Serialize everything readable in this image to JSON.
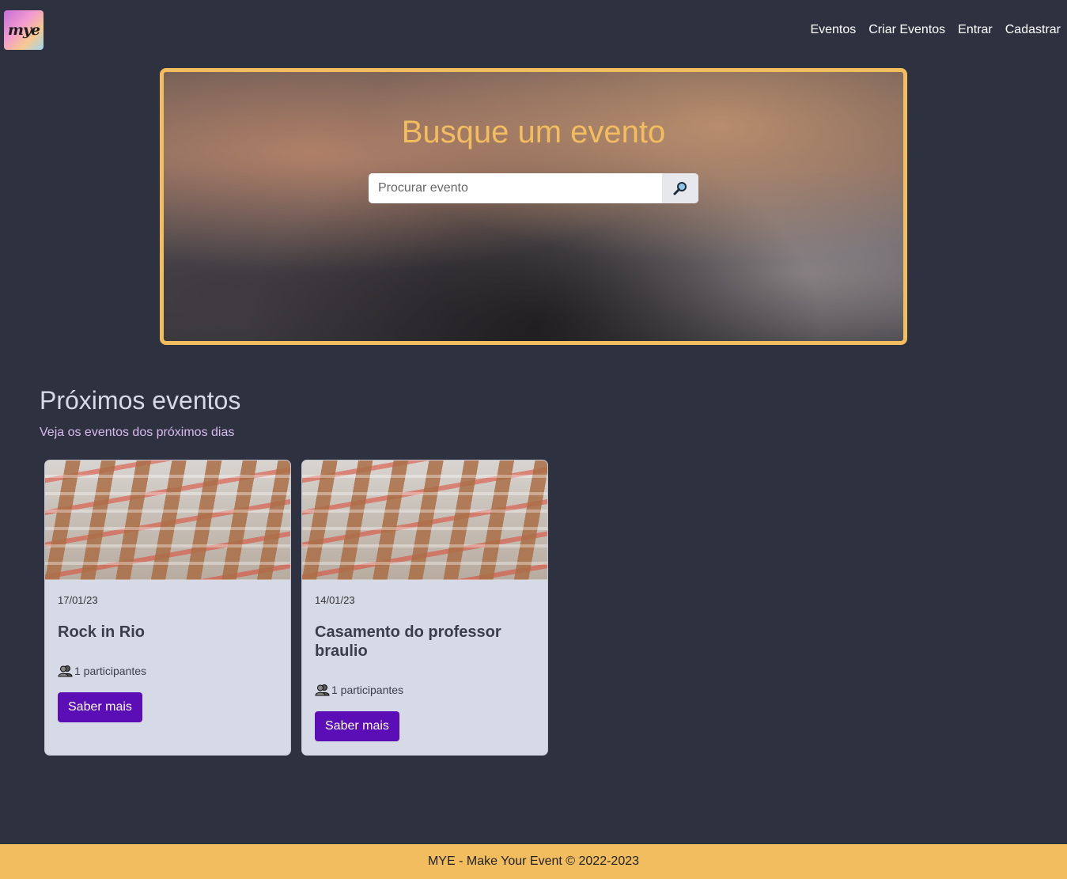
{
  "header": {
    "logo_text": "mye",
    "nav": [
      "Eventos",
      "Criar Eventos",
      "Entrar",
      "Cadastrar"
    ]
  },
  "hero": {
    "title": "Busque um evento",
    "search_placeholder": "Procurar evento",
    "search_icon": "magnifier-icon"
  },
  "section": {
    "title": "Próximos eventos",
    "subtitle": "Veja os eventos dos próximos dias"
  },
  "events": [
    {
      "date": "17/01/23",
      "title": "Rock in Rio",
      "participants": "1 participantes",
      "button": "Saber mais"
    },
    {
      "date": "14/01/23",
      "title": "Casamento do professor braulio",
      "participants": "1 participantes",
      "button": "Saber mais"
    }
  ],
  "footer": {
    "text": "MYE - Make Your Event © 2022-2023"
  },
  "colors": {
    "background": "#2e3240",
    "accent": "#f1bd5f",
    "button": "#5b0db6",
    "card": "#d6dae6"
  }
}
